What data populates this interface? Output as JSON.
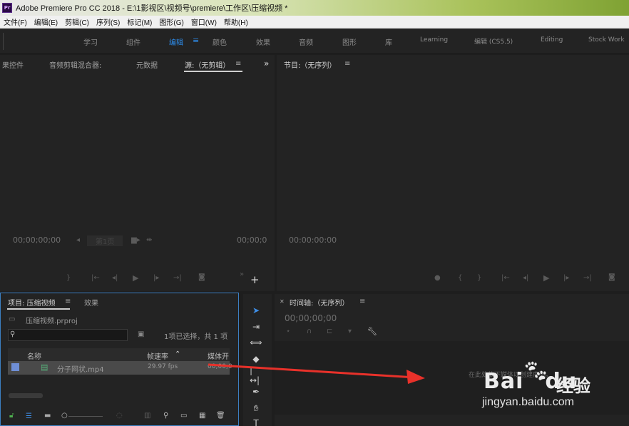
{
  "window": {
    "app_icon": "Pr",
    "title": "Adobe Premiere Pro CC 2018 - E:\\1影视区\\视频号\\premiere\\工作区\\压缩视频 *"
  },
  "menu": [
    "文件(F)",
    "编辑(E)",
    "剪辑(C)",
    "序列(S)",
    "标记(M)",
    "图形(G)",
    "窗口(W)",
    "帮助(H)"
  ],
  "workspaces": [
    "学习",
    "组件",
    "编辑",
    "颜色",
    "效果",
    "音频",
    "图形",
    "库",
    "Learning",
    "编辑 (CS5.5)",
    "Editing",
    "Stock Work"
  ],
  "workspace_active": "编辑",
  "source_panel": {
    "tabs": [
      "果控件",
      "音频剪辑混合器:",
      "元数据",
      "源:（无剪辑）"
    ],
    "overflow": "»",
    "timecode_left": "00;00;00;00",
    "timecode_right": "00;00;0",
    "zoom_label": "第1页",
    "add": "+"
  },
  "program_panel": {
    "title": "节目:（无序列）",
    "timecode": "00:00:00:00"
  },
  "project_panel": {
    "tabs": [
      "项目: 压缩视频",
      "效果"
    ],
    "project_file": "压缩视频.prproj",
    "selection_info": "1项已选择，共 1 项",
    "columns": [
      "名称",
      "帧速率",
      "媒体开"
    ],
    "item": {
      "name": "分子网状.mp4",
      "fps": "29.97 fps",
      "media_start": "00;00;0"
    }
  },
  "timeline_panel": {
    "title": "时间轴:（无序列）",
    "timecode": "00;00;00;00",
    "drop_hint": "在此处放下媒体以创建序列。"
  },
  "watermark": {
    "logo": "Bai",
    "logo_du": "du",
    "cn": "经验",
    "url": "jingyan.baidu.com"
  },
  "colors": {
    "accent": "#2d8ceb",
    "arrow": "#e8312a",
    "panel": "#232323"
  }
}
